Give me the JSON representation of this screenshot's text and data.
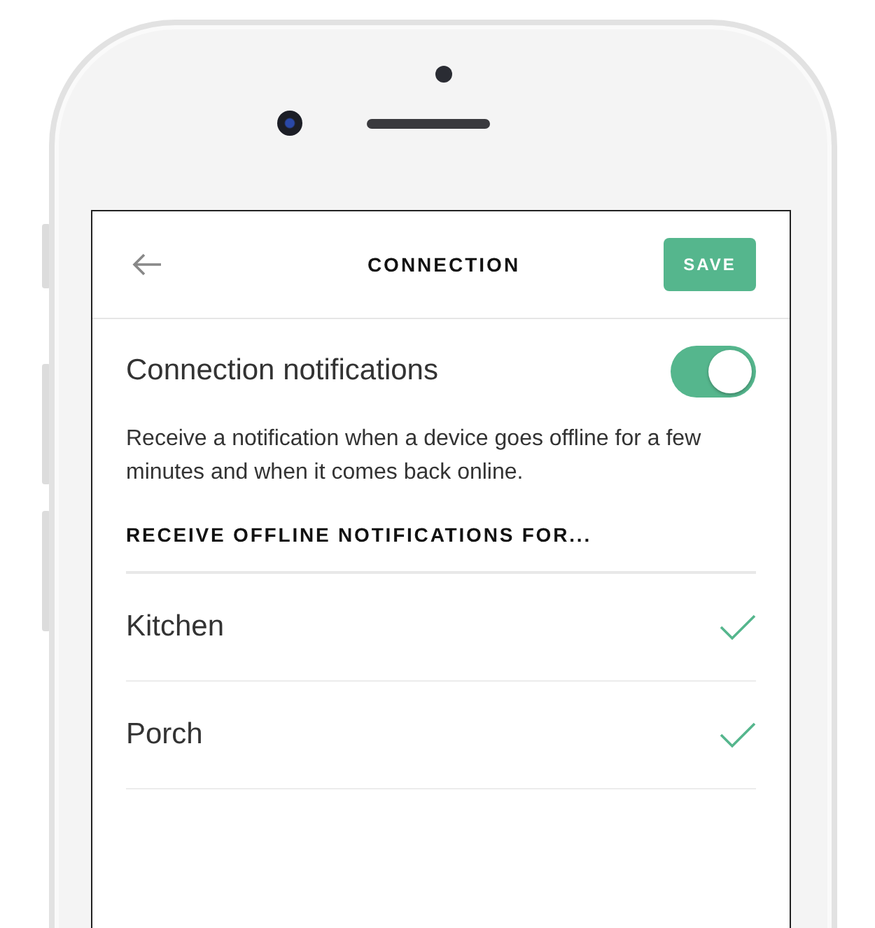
{
  "header": {
    "title": "CONNECTION",
    "save_button": "SAVE"
  },
  "notifications": {
    "label": "Connection notifications",
    "on": true
  },
  "description": "Receive a notification when a device goes offline for a few minutes and when it comes back online.",
  "section_heading": "RECEIVE OFFLINE NOTIFICATIONS FOR...",
  "devices": [
    {
      "name": "Kitchen",
      "checked": true
    },
    {
      "name": "Porch",
      "checked": true
    }
  ]
}
